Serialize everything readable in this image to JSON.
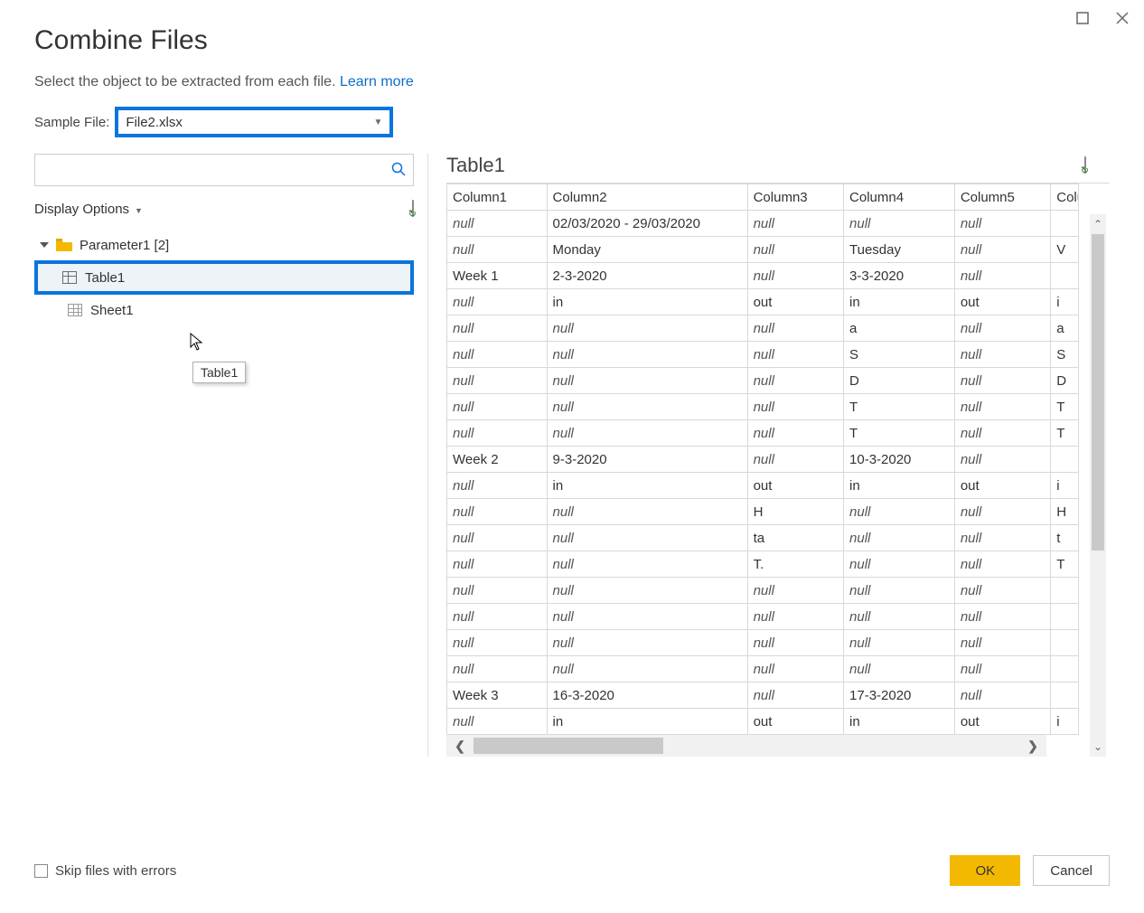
{
  "title": "Combine Files",
  "subtitle_text": "Select the object to be extracted from each file. ",
  "learn_more": "Learn more",
  "sample_file_label": "Sample File:",
  "sample_file_value": "File2.xlsx",
  "display_options_label": "Display Options",
  "tree": {
    "root_label": "Parameter1 [2]",
    "table_label": "Table1",
    "sheet_label": "Sheet1"
  },
  "tooltip_text": "Table1",
  "right_title": "Table1",
  "columns": [
    "Column1",
    "Column2",
    "Column3",
    "Column4",
    "Column5",
    "Colu"
  ],
  "null_text": "null",
  "rows": [
    {
      "c1": null,
      "c2": "02/03/2020 - 29/03/2020",
      "c3": null,
      "c4": null,
      "c5": null,
      "c6": ""
    },
    {
      "c1": null,
      "c2": "Monday",
      "c3": "",
      "c4t": null,
      "c4": "Tuesday",
      "c5": null,
      "c6": "V",
      "c3null": true
    },
    {
      "c1": "Week 1",
      "c2": "2-3-2020",
      "c2r": true,
      "c3": null,
      "c4": "3-3-2020",
      "c4r": true,
      "c5": null,
      "c6": ""
    },
    {
      "c1": null,
      "c2": "in",
      "c3": "out",
      "c4": "in",
      "c5": "out",
      "c6": "i"
    },
    {
      "c1": null,
      "c2": null,
      "c3": null,
      "c4": "a",
      "c5": null,
      "c6": "a"
    },
    {
      "c1": null,
      "c2": null,
      "c3": null,
      "c4": "S",
      "c5": null,
      "c6": "S"
    },
    {
      "c1": null,
      "c2": null,
      "c3": null,
      "c4": "D",
      "c5": null,
      "c6": "D"
    },
    {
      "c1": null,
      "c2": null,
      "c3": null,
      "c4": "T",
      "c5": null,
      "c6": "T"
    },
    {
      "c1": null,
      "c2": null,
      "c3": null,
      "c4": "T",
      "c5": null,
      "c6": "T"
    },
    {
      "c1": "Week 2",
      "c2": "9-3-2020",
      "c2r": true,
      "c3": null,
      "c4": "10-3-2020",
      "c4r": true,
      "c5": null,
      "c6": ""
    },
    {
      "c1": null,
      "c2": "in",
      "c3": "out",
      "c4": "in",
      "c5": "out",
      "c6": "i"
    },
    {
      "c1": null,
      "c2": null,
      "c3": "H",
      "c4": null,
      "c5": null,
      "c6": "H"
    },
    {
      "c1": null,
      "c2": null,
      "c3": "ta",
      "c4": null,
      "c5": null,
      "c6": "t"
    },
    {
      "c1": null,
      "c2": null,
      "c3": "T.",
      "c4": null,
      "c5": null,
      "c6": "T"
    },
    {
      "c1": null,
      "c2": null,
      "c3": null,
      "c4": null,
      "c5": null,
      "c6": ""
    },
    {
      "c1": null,
      "c2": null,
      "c3": null,
      "c4": null,
      "c5": null,
      "c6": ""
    },
    {
      "c1": null,
      "c2": null,
      "c3": null,
      "c4": null,
      "c5": null,
      "c6": ""
    },
    {
      "c1": null,
      "c2": null,
      "c3": null,
      "c4": null,
      "c5": null,
      "c6": ""
    },
    {
      "c1": "Week 3",
      "c2": "16-3-2020",
      "c2r": true,
      "c3": null,
      "c4": "17-3-2020",
      "c4r": true,
      "c5": null,
      "c6": ""
    },
    {
      "c1": null,
      "c2": "in",
      "c3": "out",
      "c4": "in",
      "c5": "out",
      "c6": "i"
    }
  ],
  "skip_files_label": "Skip files with errors",
  "ok_label": "OK",
  "cancel_label": "Cancel"
}
